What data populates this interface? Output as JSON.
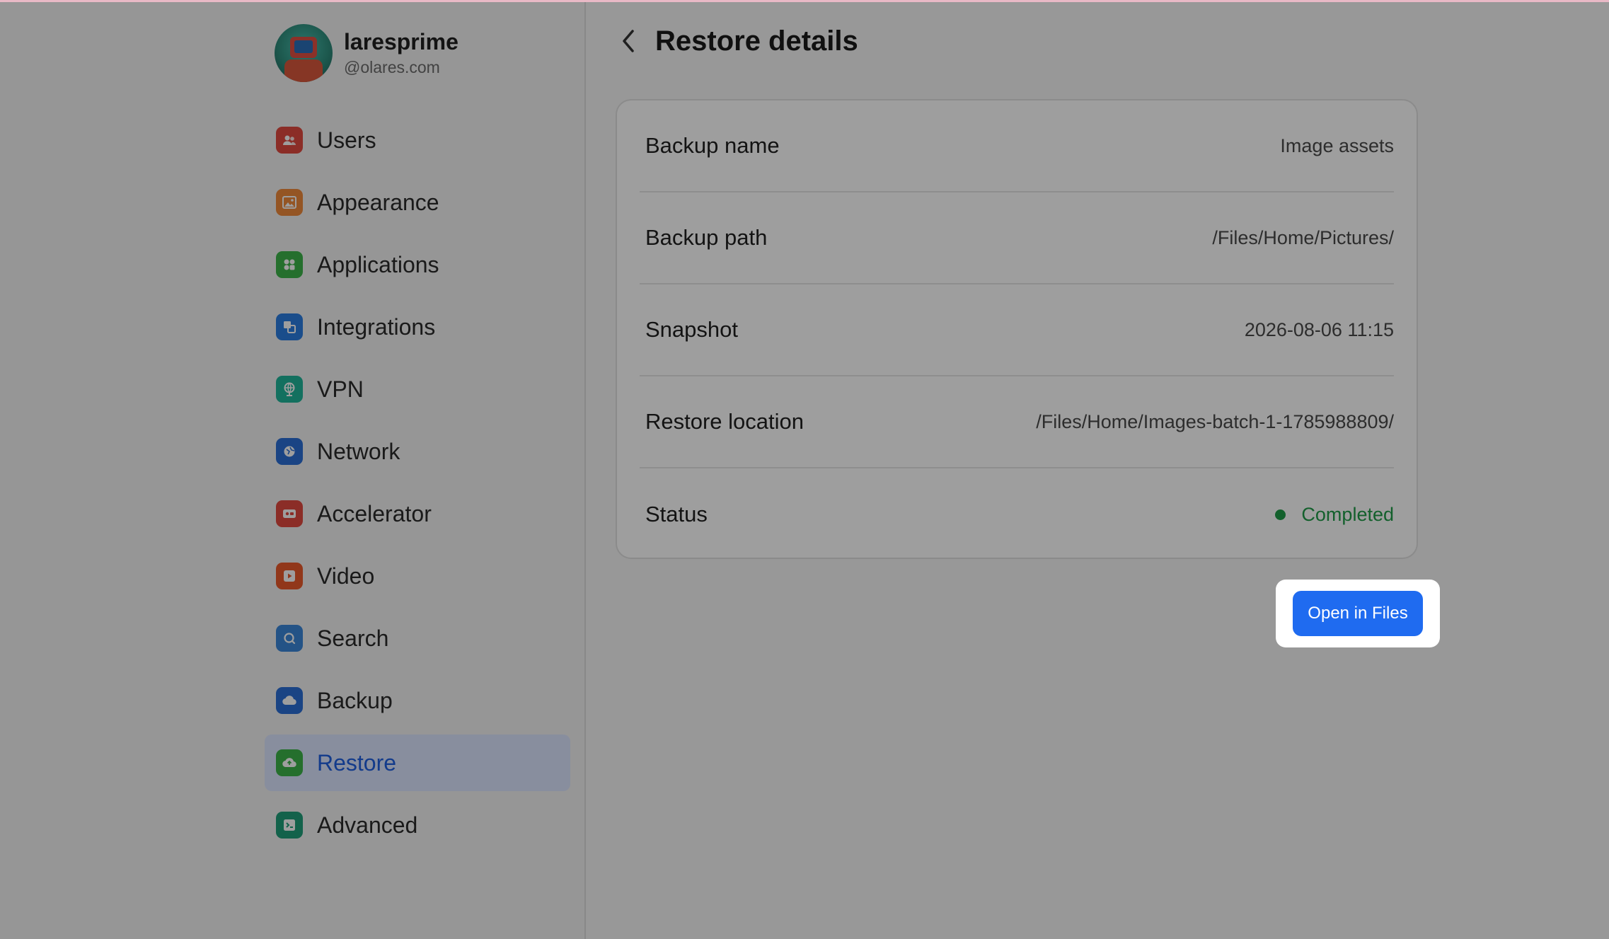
{
  "profile": {
    "name": "laresprime",
    "domain": "@olares.com"
  },
  "sidebar": {
    "items": [
      {
        "label": "Users",
        "icon": "users-icon",
        "color": "#e0493f"
      },
      {
        "label": "Appearance",
        "icon": "image-icon",
        "color": "#ef8a3b"
      },
      {
        "label": "Applications",
        "icon": "apps-icon",
        "color": "#3db34a"
      },
      {
        "label": "Integrations",
        "icon": "integrations-icon",
        "color": "#2a7de1"
      },
      {
        "label": "VPN",
        "icon": "globe-icon",
        "color": "#1fb59a"
      },
      {
        "label": "Network",
        "icon": "network-icon",
        "color": "#2a6fd6"
      },
      {
        "label": "Accelerator",
        "icon": "accelerator-icon",
        "color": "#e0493f"
      },
      {
        "label": "Video",
        "icon": "play-icon",
        "color": "#ea5a2b"
      },
      {
        "label": "Search",
        "icon": "search-icon",
        "color": "#3a86d8"
      },
      {
        "label": "Backup",
        "icon": "cloud-icon",
        "color": "#2a6fd6"
      },
      {
        "label": "Restore",
        "icon": "cloud-restore-icon",
        "color": "#3db34a",
        "active": true
      },
      {
        "label": "Advanced",
        "icon": "terminal-icon",
        "color": "#1f9e7a"
      }
    ]
  },
  "header": {
    "title": "Restore details"
  },
  "details": {
    "backup_name_label": "Backup name",
    "backup_name_value": "Image assets",
    "backup_path_label": "Backup path",
    "backup_path_value": "/Files/Home/Pictures/",
    "snapshot_label": "Snapshot",
    "snapshot_value": "2026-08-06 11:15",
    "restore_location_label": "Restore location",
    "restore_location_value": "/Files/Home/Images-batch-1-1785988809/",
    "status_label": "Status",
    "status_value": "Completed",
    "status_color": "#1f9b48"
  },
  "actions": {
    "open_in_files": "Open in Files"
  },
  "colors": {
    "accent": "#1f6bf0",
    "active_nav_bg": "#dbe6ff"
  }
}
